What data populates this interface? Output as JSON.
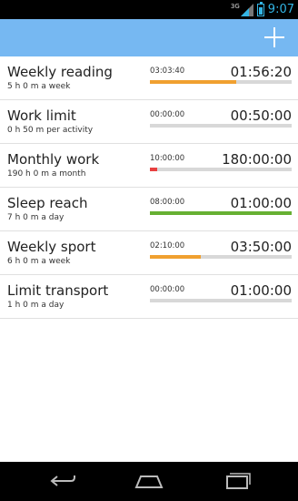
{
  "status_bar": {
    "network": "3G",
    "time": "9:07"
  },
  "action_bar": {
    "add_icon": "plus-icon"
  },
  "goals": [
    {
      "name": "Weekly reading",
      "subtitle": "5 h 0 m a week",
      "elapsed": "03:03:40",
      "target": "01:56:20",
      "progress": 0.61,
      "color": "#f0a030"
    },
    {
      "name": "Work limit",
      "subtitle": "0 h 50 m per activity",
      "elapsed": "00:00:00",
      "target": "00:50:00",
      "progress": 0,
      "color": "#f0a030"
    },
    {
      "name": "Monthly work",
      "subtitle": "190 h 0 m a month",
      "elapsed": "10:00:00",
      "target": "180:00:00",
      "progress": 0.053,
      "color": "#e84040"
    },
    {
      "name": "Sleep reach",
      "subtitle": "7 h 0 m a day",
      "elapsed": "08:00:00",
      "target": "01:00:00",
      "progress": 1,
      "color": "#66b032"
    },
    {
      "name": "Weekly sport",
      "subtitle": "6 h 0 m a week",
      "elapsed": "02:10:00",
      "target": "03:50:00",
      "progress": 0.36,
      "color": "#f0a030"
    },
    {
      "name": "Limit transport",
      "subtitle": "1 h 0 m a day",
      "elapsed": "00:00:00",
      "target": "01:00:00",
      "progress": 0,
      "color": "#f0a030"
    }
  ],
  "nav_bar": {
    "back_icon": "back-icon",
    "home_icon": "home-icon",
    "recents_icon": "recents-icon"
  }
}
